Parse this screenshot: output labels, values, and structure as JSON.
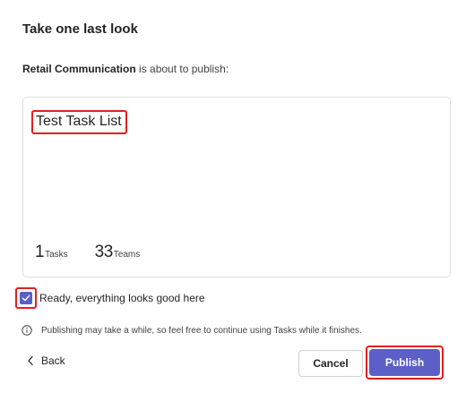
{
  "dialog": {
    "title": "Take one last look",
    "subtitle": {
      "team_name": "Retail Communication",
      "suffix": " is about to publish:"
    }
  },
  "card": {
    "list_name": "Test Task List",
    "stats": [
      {
        "value": "1",
        "label": "Tasks"
      },
      {
        "value": "33",
        "label": "Teams"
      }
    ]
  },
  "confirm": {
    "checked": true,
    "label": "Ready, everything looks good here"
  },
  "info": {
    "icon": "info-icon",
    "text": "Publishing may take a while, so feel free to continue using Tasks while it finishes."
  },
  "footer": {
    "back_label": "Back",
    "cancel_label": "Cancel",
    "publish_label": "Publish"
  },
  "colors": {
    "accent": "#5b5fc7",
    "highlight": "#e02020"
  }
}
